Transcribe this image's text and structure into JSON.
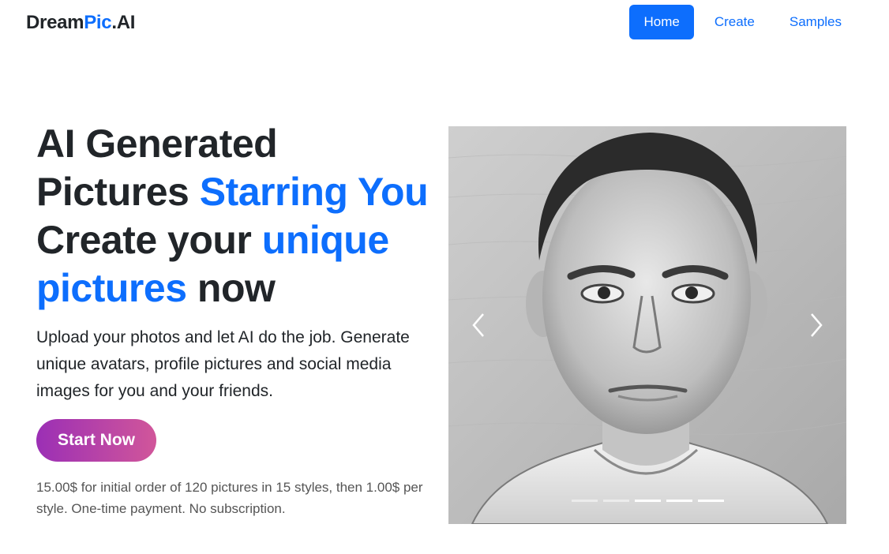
{
  "brand": {
    "part1": "Dream",
    "part2": "Pic",
    "part3": ".AI"
  },
  "nav": {
    "items": [
      {
        "label": "Home",
        "active": true
      },
      {
        "label": "Create",
        "active": false
      },
      {
        "label": "Samples",
        "active": false
      }
    ]
  },
  "hero": {
    "line1": "AI Generated",
    "line2_plain": "Pictures ",
    "line2_highlight": "Starring You",
    "line3_plain": "Create your ",
    "line3_highlight": "unique",
    "line4_highlight": "pictures",
    "line4_plain": " now",
    "lead": "Upload your photos and let AI do the job. Generate unique avatars, profile pictures and social media images for you and your friends.",
    "cta_label": "Start Now",
    "price_note": "15.00$ for initial order of 120 pictures in 15 styles, then 1.00$ per style. One-time payment. No subscription."
  },
  "carousel": {
    "slide_count": 5,
    "active_index": 2,
    "prev_icon": "chevron-left-icon",
    "next_icon": "chevron-right-icon"
  },
  "colors": {
    "primary": "#0d6efd",
    "cta_gradient_start": "#9b2fb5",
    "cta_gradient_end": "#d1569a"
  }
}
